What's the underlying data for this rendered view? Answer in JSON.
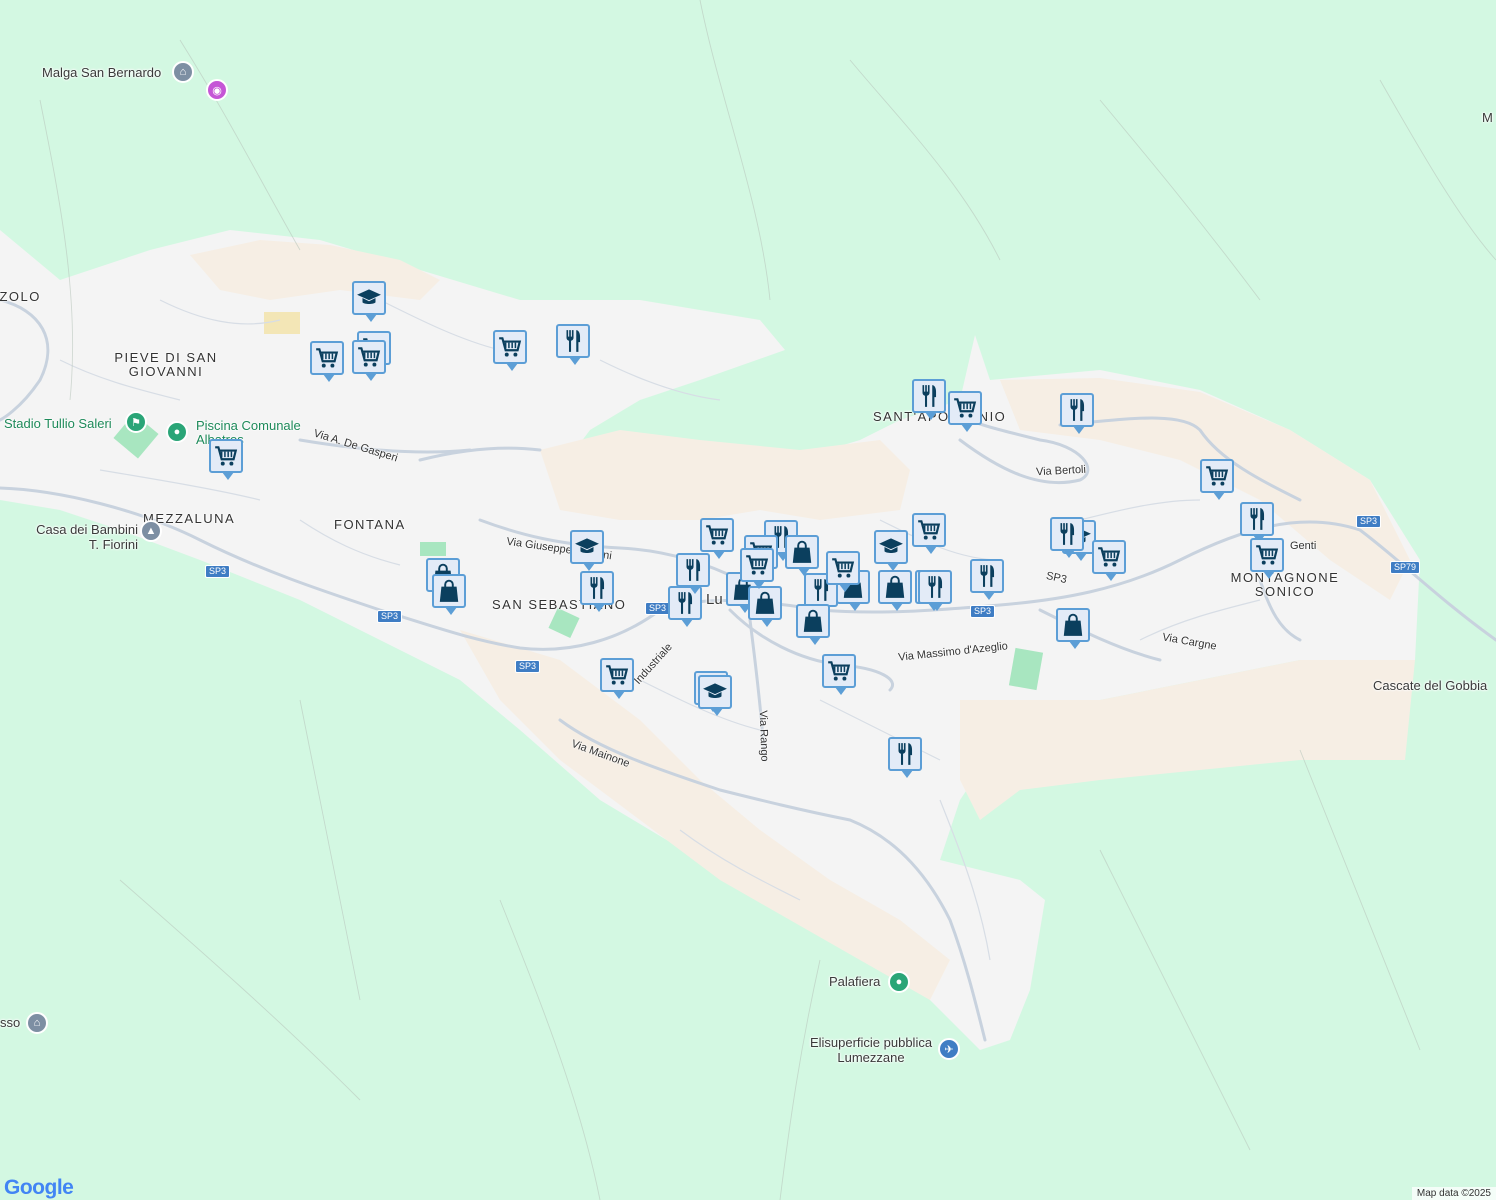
{
  "map": {
    "colors": {
      "forest": "#d3f8e2",
      "urban": "#f4f4f4",
      "scrub": "#f6eee4",
      "road": "#b8c4d4",
      "marker_fill": "#e3ebf7",
      "marker_border": "#5c9ed6",
      "marker_icon": "#0b3f5e",
      "route_shield": "#3f7dc4"
    },
    "place_labels": [
      {
        "id": "malga",
        "text": "Malga San Bernardo"
      },
      {
        "id": "pieve",
        "text": "PIEVE DI SAN GIOVANNI"
      },
      {
        "id": "stadio",
        "text": "Stadio Tullio Saleri"
      },
      {
        "id": "piscina",
        "text": "Piscina Comunale Albatros"
      },
      {
        "id": "mezzaluna",
        "text": "MEZZALUNA"
      },
      {
        "id": "fontana",
        "text": "FONTANA"
      },
      {
        "id": "casa",
        "text": "Casa dei Bambini T. Fiorini"
      },
      {
        "id": "sansebastiano",
        "text": "SAN SEBASTIANO"
      },
      {
        "id": "santapollonio",
        "text": "SANT'APOLLONIO"
      },
      {
        "id": "montagnone",
        "text": "MONTAGNONE SONICO"
      },
      {
        "id": "cascate",
        "text": "Cascate del Gobbia"
      },
      {
        "id": "palafiera",
        "text": "Palafiera"
      },
      {
        "id": "elisuperficie",
        "text": "Elisuperficie pubblica Lumezzane"
      },
      {
        "id": "lumezzane",
        "text": "Lu"
      },
      {
        "id": "zolo",
        "text": "ZZOLO"
      },
      {
        "id": "sso",
        "text": "sso"
      },
      {
        "id": "m",
        "text": "M"
      }
    ],
    "street_labels": [
      {
        "id": "degasperi",
        "text": "Via A. De Gasperi"
      },
      {
        "id": "mazzini",
        "text": "Via Giuseppe Mazzini"
      },
      {
        "id": "industriale",
        "text": "Industriale"
      },
      {
        "id": "mainone",
        "text": "Via Mainone"
      },
      {
        "id": "rango",
        "text": "Via Rango"
      },
      {
        "id": "azeglio",
        "text": "Via Massimo d'Azeglio"
      },
      {
        "id": "cargne",
        "text": "Via Cargne"
      },
      {
        "id": "bertoli",
        "text": "Via Bertoli"
      },
      {
        "id": "sp3text",
        "text": "SP3"
      },
      {
        "id": "genti",
        "text": "Genti"
      }
    ],
    "route_shields": [
      "SP3",
      "SP3",
      "SP3",
      "SP3",
      "SP3",
      "SP3",
      "SP79"
    ],
    "markers": [
      {
        "type": "school",
        "icon": "school-icon"
      },
      {
        "type": "grocery",
        "icon": "shopping-cart-icon"
      },
      {
        "type": "grocery",
        "icon": "shopping-cart-icon"
      },
      {
        "type": "grocery",
        "icon": "shopping-cart-icon"
      },
      {
        "type": "grocery",
        "icon": "shopping-cart-icon"
      },
      {
        "type": "restaurant",
        "icon": "fork-knife-icon"
      },
      {
        "type": "grocery",
        "icon": "shopping-cart-icon"
      },
      {
        "type": "shop",
        "icon": "shopping-bag-icon"
      },
      {
        "type": "shop",
        "icon": "shopping-bag-icon"
      },
      {
        "type": "school",
        "icon": "school-icon"
      },
      {
        "type": "restaurant",
        "icon": "fork-knife-icon"
      },
      {
        "type": "grocery",
        "icon": "shopping-cart-icon"
      },
      {
        "type": "restaurant",
        "icon": "fork-knife-icon"
      },
      {
        "type": "restaurant",
        "icon": "fork-knife-icon"
      },
      {
        "type": "grocery",
        "icon": "shopping-cart-icon"
      },
      {
        "type": "restaurant",
        "icon": "fork-knife-icon"
      },
      {
        "type": "grocery",
        "icon": "shopping-cart-icon"
      },
      {
        "type": "shop",
        "icon": "shopping-bag-icon"
      },
      {
        "type": "restaurant",
        "icon": "fork-knife-icon"
      },
      {
        "type": "shop",
        "icon": "shopping-bag-icon"
      },
      {
        "type": "shop",
        "icon": "shopping-bag-icon"
      },
      {
        "type": "shop",
        "icon": "shopping-bag-icon"
      },
      {
        "type": "restaurant",
        "icon": "fork-knife-icon"
      },
      {
        "type": "shop",
        "icon": "shopping-bag-icon"
      },
      {
        "type": "school",
        "icon": "school-icon"
      },
      {
        "type": "shop",
        "icon": "shopping-bag-icon"
      },
      {
        "type": "grocery",
        "icon": "shopping-cart-icon"
      },
      {
        "type": "restaurant",
        "icon": "fork-knife-icon"
      },
      {
        "type": "grocery",
        "icon": "shopping-cart-icon"
      },
      {
        "type": "school",
        "icon": "school-icon"
      },
      {
        "type": "restaurant",
        "icon": "fork-knife-icon"
      },
      {
        "type": "restaurant",
        "icon": "fork-knife-icon"
      },
      {
        "type": "grocery",
        "icon": "shopping-cart-icon"
      },
      {
        "type": "restaurant",
        "icon": "fork-knife-icon"
      },
      {
        "type": "restaurant",
        "icon": "fork-knife-icon"
      },
      {
        "type": "grocery",
        "icon": "shopping-cart-icon"
      },
      {
        "type": "school",
        "icon": "school-icon"
      },
      {
        "type": "grocery",
        "icon": "shopping-cart-icon"
      },
      {
        "type": "shop",
        "icon": "shopping-bag-icon"
      },
      {
        "type": "grocery",
        "icon": "shopping-cart-icon"
      },
      {
        "type": "restaurant",
        "icon": "fork-knife-icon"
      },
      {
        "type": "grocery",
        "icon": "shopping-cart-icon"
      },
      {
        "type": "grocery",
        "icon": "shopping-cart-icon"
      },
      {
        "type": "school",
        "icon": "school-icon"
      },
      {
        "type": "restaurant",
        "icon": "fork-knife-icon"
      }
    ],
    "attribution": {
      "logo": "Google",
      "map_data": "Map data ©2025"
    }
  }
}
